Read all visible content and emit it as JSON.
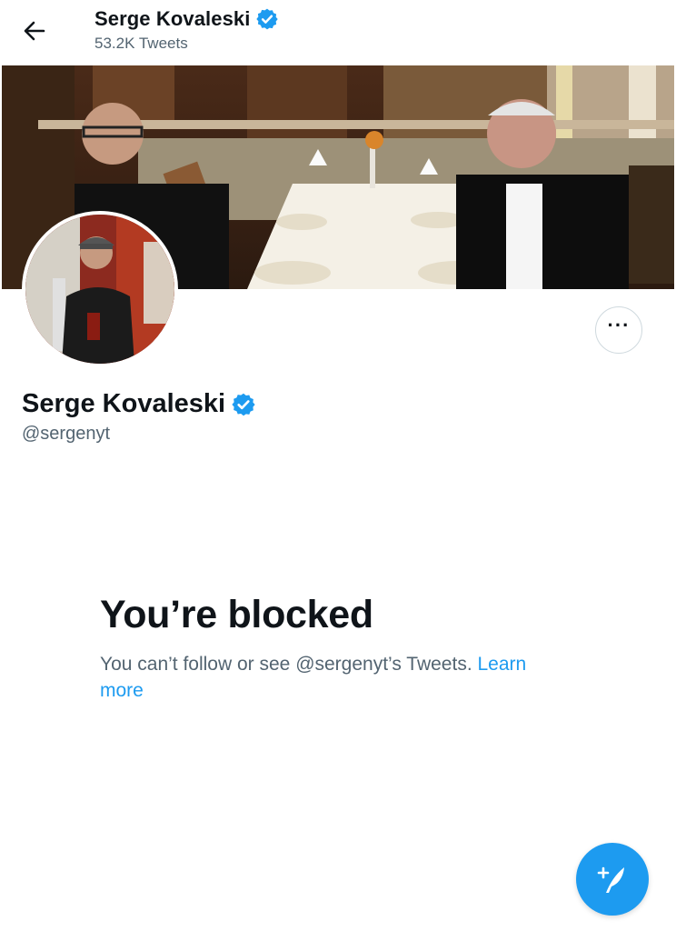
{
  "header": {
    "name": "Serge Kovaleski",
    "tweet_count": "53.2K Tweets",
    "back_icon": "arrow-left-icon"
  },
  "profile": {
    "name": "Serge Kovaleski",
    "handle": "@sergenyt",
    "verified_icon": "verified-badge-icon",
    "more_icon": "more-options-icon"
  },
  "blocked": {
    "title": "You’re blocked",
    "description": "You can’t follow or see @sergenyt’s Tweets.",
    "learn_more": "Learn more"
  },
  "fab": {
    "icon": "compose-tweet-icon"
  },
  "colors": {
    "accent": "#1d9bf0",
    "text": "#0f1419",
    "secondary_text": "#536471"
  }
}
